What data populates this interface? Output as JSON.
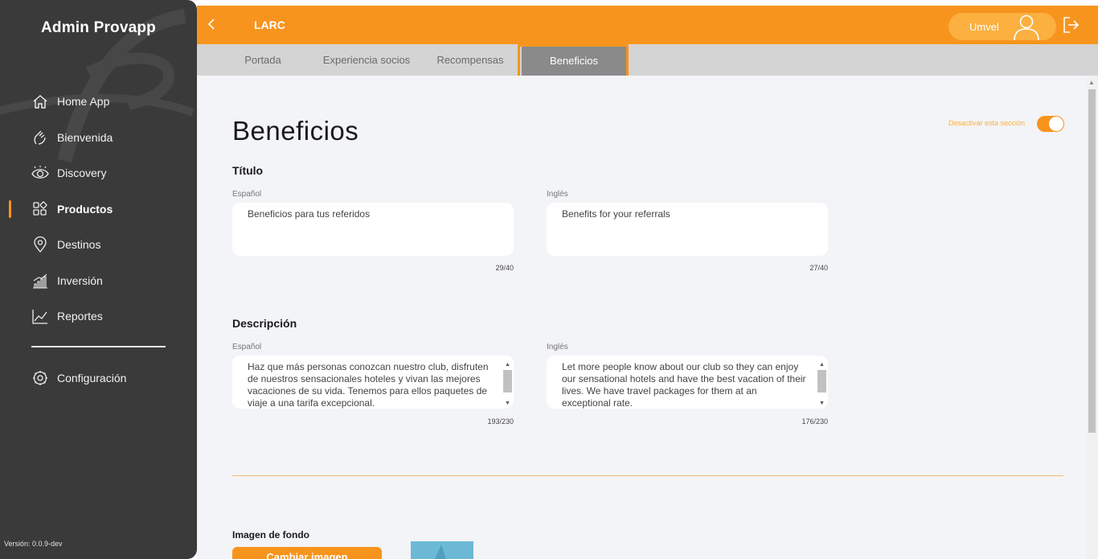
{
  "sidebar": {
    "brand": "Admin Provapp",
    "items": [
      {
        "label": "Home App",
        "icon": "home-icon"
      },
      {
        "label": "Bienvenida",
        "icon": "wave-hand-icon"
      },
      {
        "label": "Discovery",
        "icon": "eye-icon"
      },
      {
        "label": "Productos",
        "icon": "grid-icon",
        "active": true
      },
      {
        "label": "Destinos",
        "icon": "location-pin-icon"
      },
      {
        "label": "Inversión",
        "icon": "bar-chart-icon"
      },
      {
        "label": "Reportes",
        "icon": "line-chart-icon"
      }
    ],
    "config_label": "Configuración",
    "version": "Versión: 0.0.9-dev"
  },
  "header": {
    "app_name": "LARC",
    "user_name": "Umvel"
  },
  "tabs": [
    {
      "label": "Portada"
    },
    {
      "label": "Experiencia socios"
    },
    {
      "label": "Recompensas"
    },
    {
      "label": "Beneficios",
      "active": true
    }
  ],
  "main": {
    "page_title": "Beneficios",
    "toggle_label": "Desactivar esta sección",
    "toggle_on": true,
    "title_section": {
      "heading": "Título",
      "es_label": "Español",
      "es_value": "Beneficios para tus referidos",
      "es_count": "29/40",
      "en_label": "Inglés",
      "en_value": "Benefits for your referrals",
      "en_count": "27/40"
    },
    "description_section": {
      "heading": "Descripción",
      "es_label": "Español",
      "es_value": "Haz que más personas conozcan nuestro club, disfruten de nuestros sensacionales hoteles y vivan las mejores vacaciones de su vida. Tenemos para ellos paquetes de viaje a una tarifa excepcional.",
      "es_count": "193/230",
      "en_label": "Inglés",
      "en_value": "Let more people know about our club so they can enjoy our sensational hotels and have the best vacation of their lives. We have travel packages for them at an exceptional rate.",
      "en_count": "176/230"
    },
    "background_label": "Imagen de fondo",
    "change_image_button": "Cambiar imagen"
  },
  "colors": {
    "accent": "#f7941e",
    "sidebar_bg": "#3a3a3a",
    "tab_active_bg": "#8a8a8a"
  }
}
